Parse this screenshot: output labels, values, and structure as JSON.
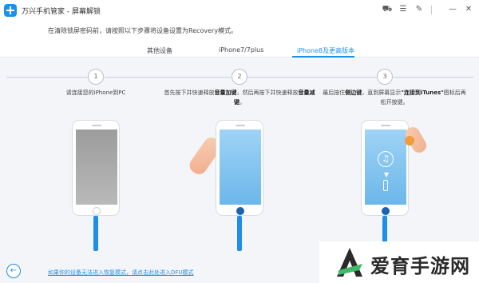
{
  "app": {
    "title": "万兴手机管家 - 屏幕解锁"
  },
  "window": {
    "icons": [
      "cart-icon",
      "menu-icon",
      "edit-icon",
      "feedback-icon",
      "minimize-icon",
      "close-icon"
    ]
  },
  "instruction": "在清除锁屏密码前，请按照以下步骤将设备设置为Recovery模式。",
  "tabs": [
    {
      "label": "其他设备",
      "active": false
    },
    {
      "label": "iPhone7/7plus",
      "active": false
    },
    {
      "label": "iPhone8及更高版本",
      "active": true
    }
  ],
  "steps": [
    {
      "number": "1",
      "text": "请连接您的iPhone到PC"
    },
    {
      "number": "2",
      "text_a": "首先按下并快速释放",
      "bold_a": "音量加键",
      "text_b": "，然后再按下并快速释放",
      "bold_b": "音量减键",
      "text_c": "。"
    },
    {
      "number": "3",
      "text_a": "最后按住",
      "bold_a": "侧边键",
      "text_b": "，直到屏幕显示",
      "bold_b": "\"连接到iTunes\"",
      "text_c": "图标后再松开按键。"
    }
  ],
  "bottom": {
    "back_icon": "arrow-left-icon",
    "dfu_link": "如果你的设备无法进入恢复模式，请点击此处进入DFU模式"
  },
  "watermark": {
    "text": "爱育手游网"
  },
  "colors": {
    "accent": "#1e90e8",
    "phone_screen_blue": "#7ec1ef",
    "phone_screen_gray": "#a9a9a9",
    "content_bg": "#f3f5f8"
  }
}
